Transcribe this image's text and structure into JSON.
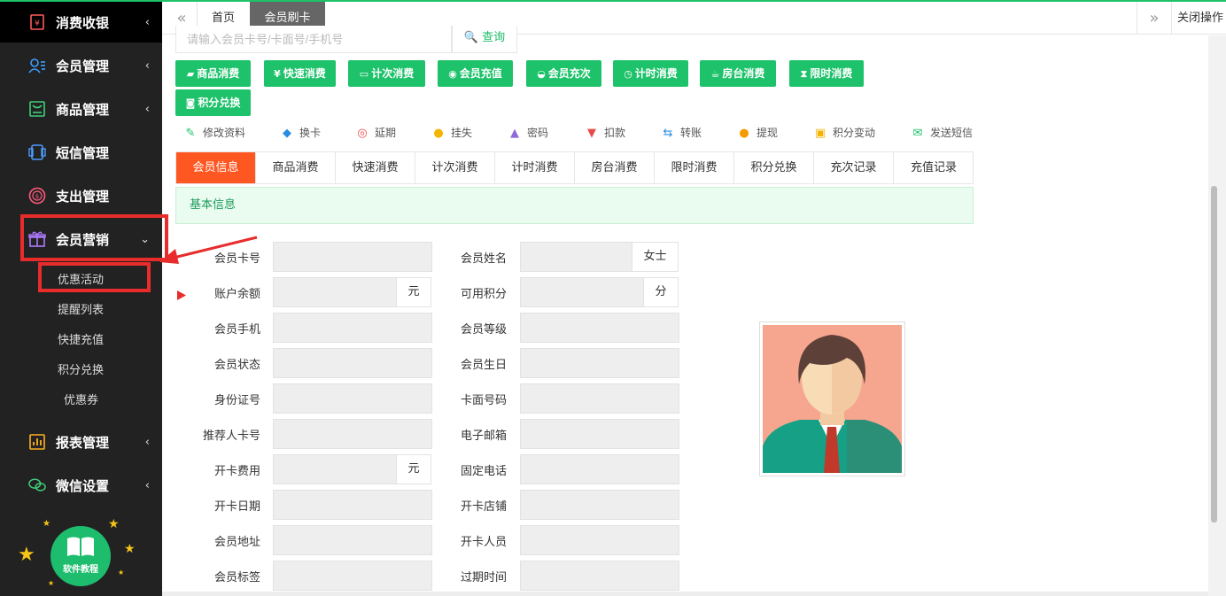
{
  "sidebar": {
    "items": [
      {
        "label": "消费收银",
        "chev": "‹",
        "icon": "cashier-icon"
      },
      {
        "label": "会员管理",
        "chev": "‹",
        "icon": "member-icon"
      },
      {
        "label": "商品管理",
        "chev": "‹",
        "icon": "goods-icon"
      },
      {
        "label": "短信管理",
        "chev": "",
        "icon": "sms-icon"
      },
      {
        "label": "支出管理",
        "chev": "",
        "icon": "expense-icon"
      },
      {
        "label": "会员营销",
        "chev": "⌄",
        "icon": "gift-icon"
      },
      {
        "label": "报表管理",
        "chev": "‹",
        "icon": "report-icon"
      },
      {
        "label": "微信设置",
        "chev": "‹",
        "icon": "wechat-icon"
      }
    ],
    "subitems": [
      "优惠活动",
      "提醒列表",
      "快捷充值",
      "积分兑换",
      "优惠券"
    ],
    "tutorial_label": "软件教程"
  },
  "tabs": {
    "home": "首页",
    "current": "会员刷卡",
    "close_ops": "关闭操作",
    "prev": "«",
    "next": "»"
  },
  "search": {
    "placeholder": "请输入会员卡号/卡面号/手机号",
    "button": "🔍 查询"
  },
  "action_buttons": [
    {
      "icon": "▰",
      "label": "商品消费"
    },
    {
      "icon": "¥",
      "label": "快速消费"
    },
    {
      "icon": "▭",
      "label": "计次消费"
    },
    {
      "icon": "◉",
      "label": "会员充值"
    },
    {
      "icon": "◒",
      "label": "会员充次"
    },
    {
      "icon": "◷",
      "label": "计时消费"
    },
    {
      "icon": "☕",
      "label": "房台消费"
    },
    {
      "icon": "⧗",
      "label": "限时消费"
    },
    {
      "icon": "◙",
      "label": "积分兑换"
    }
  ],
  "links": [
    {
      "icon": "✎",
      "label": "修改资料",
      "color": "#1ec26a"
    },
    {
      "icon": "◆",
      "label": "换卡",
      "color": "#2b8de0"
    },
    {
      "icon": "◎",
      "label": "延期",
      "color": "#e84a4a"
    },
    {
      "icon": "●",
      "label": "挂失",
      "color": "#f5b400"
    },
    {
      "icon": "▲",
      "label": "密码",
      "color": "#8e6bd8"
    },
    {
      "icon": "▼",
      "label": "扣款",
      "color": "#e84a4a"
    },
    {
      "icon": "⇆",
      "label": "转账",
      "color": "#2b8de0"
    },
    {
      "icon": "●",
      "label": "提现",
      "color": "#f59a00"
    },
    {
      "icon": "▣",
      "label": "积分变动",
      "color": "#f5b400"
    },
    {
      "icon": "✉",
      "label": "发送短信",
      "color": "#1ec26a"
    }
  ],
  "subtabs": [
    "会员信息",
    "商品消费",
    "快速消费",
    "计次消费",
    "计时消费",
    "房台消费",
    "限时消费",
    "积分兑换",
    "充次记录",
    "充值记录"
  ],
  "basic_info_title": "基本信息",
  "form_left": [
    {
      "label": "会员卡号",
      "value": "",
      "suffix": ""
    },
    {
      "label": "账户余额",
      "value": "",
      "suffix": "元"
    },
    {
      "label": "会员手机",
      "value": "",
      "suffix": ""
    },
    {
      "label": "会员状态",
      "value": "",
      "suffix": ""
    },
    {
      "label": "身份证号",
      "value": "",
      "suffix": ""
    },
    {
      "label": "推荐人卡号",
      "value": "",
      "suffix": ""
    },
    {
      "label": "开卡费用",
      "value": "",
      "suffix": "元"
    },
    {
      "label": "开卡日期",
      "value": "",
      "suffix": ""
    },
    {
      "label": "会员地址",
      "value": "",
      "suffix": ""
    },
    {
      "label": "会员标签",
      "value": "",
      "suffix": ""
    }
  ],
  "form_right": [
    {
      "label": "会员姓名",
      "value": "",
      "suffix": "女士"
    },
    {
      "label": "可用积分",
      "value": "",
      "suffix": "分"
    },
    {
      "label": "会员等级",
      "value": "",
      "suffix": ""
    },
    {
      "label": "会员生日",
      "value": "",
      "suffix": ""
    },
    {
      "label": "卡面号码",
      "value": "",
      "suffix": ""
    },
    {
      "label": "电子邮箱",
      "value": "",
      "suffix": ""
    },
    {
      "label": "固定电话",
      "value": "",
      "suffix": ""
    },
    {
      "label": "开卡店铺",
      "value": "",
      "suffix": ""
    },
    {
      "label": "开卡人员",
      "value": "",
      "suffix": ""
    },
    {
      "label": "过期时间",
      "value": "",
      "suffix": ""
    }
  ],
  "colors": {
    "accent_green": "#1ec26a",
    "active_tab": "#ff5722",
    "highlight_red": "#e82c2c",
    "sidebar_bg": "#222222"
  }
}
